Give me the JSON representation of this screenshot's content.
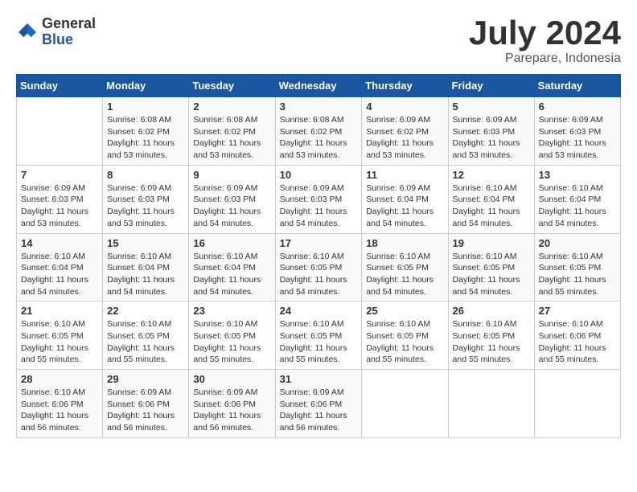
{
  "logo": {
    "general": "General",
    "blue": "Blue"
  },
  "title": "July 2024",
  "location": "Parepare, Indonesia",
  "headers": [
    "Sunday",
    "Monday",
    "Tuesday",
    "Wednesday",
    "Thursday",
    "Friday",
    "Saturday"
  ],
  "weeks": [
    [
      {
        "day": "",
        "sunrise": "",
        "sunset": "",
        "daylight": ""
      },
      {
        "day": "1",
        "sunrise": "Sunrise: 6:08 AM",
        "sunset": "Sunset: 6:02 PM",
        "daylight": "Daylight: 11 hours and 53 minutes."
      },
      {
        "day": "2",
        "sunrise": "Sunrise: 6:08 AM",
        "sunset": "Sunset: 6:02 PM",
        "daylight": "Daylight: 11 hours and 53 minutes."
      },
      {
        "day": "3",
        "sunrise": "Sunrise: 6:08 AM",
        "sunset": "Sunset: 6:02 PM",
        "daylight": "Daylight: 11 hours and 53 minutes."
      },
      {
        "day": "4",
        "sunrise": "Sunrise: 6:09 AM",
        "sunset": "Sunset: 6:02 PM",
        "daylight": "Daylight: 11 hours and 53 minutes."
      },
      {
        "day": "5",
        "sunrise": "Sunrise: 6:09 AM",
        "sunset": "Sunset: 6:03 PM",
        "daylight": "Daylight: 11 hours and 53 minutes."
      },
      {
        "day": "6",
        "sunrise": "Sunrise: 6:09 AM",
        "sunset": "Sunset: 6:03 PM",
        "daylight": "Daylight: 11 hours and 53 minutes."
      }
    ],
    [
      {
        "day": "7",
        "sunrise": "Sunrise: 6:09 AM",
        "sunset": "Sunset: 6:03 PM",
        "daylight": "Daylight: 11 hours and 53 minutes."
      },
      {
        "day": "8",
        "sunrise": "Sunrise: 6:09 AM",
        "sunset": "Sunset: 6:03 PM",
        "daylight": "Daylight: 11 hours and 53 minutes."
      },
      {
        "day": "9",
        "sunrise": "Sunrise: 6:09 AM",
        "sunset": "Sunset: 6:03 PM",
        "daylight": "Daylight: 11 hours and 54 minutes."
      },
      {
        "day": "10",
        "sunrise": "Sunrise: 6:09 AM",
        "sunset": "Sunset: 6:03 PM",
        "daylight": "Daylight: 11 hours and 54 minutes."
      },
      {
        "day": "11",
        "sunrise": "Sunrise: 6:09 AM",
        "sunset": "Sunset: 6:04 PM",
        "daylight": "Daylight: 11 hours and 54 minutes."
      },
      {
        "day": "12",
        "sunrise": "Sunrise: 6:10 AM",
        "sunset": "Sunset: 6:04 PM",
        "daylight": "Daylight: 11 hours and 54 minutes."
      },
      {
        "day": "13",
        "sunrise": "Sunrise: 6:10 AM",
        "sunset": "Sunset: 6:04 PM",
        "daylight": "Daylight: 11 hours and 54 minutes."
      }
    ],
    [
      {
        "day": "14",
        "sunrise": "Sunrise: 6:10 AM",
        "sunset": "Sunset: 6:04 PM",
        "daylight": "Daylight: 11 hours and 54 minutes."
      },
      {
        "day": "15",
        "sunrise": "Sunrise: 6:10 AM",
        "sunset": "Sunset: 6:04 PM",
        "daylight": "Daylight: 11 hours and 54 minutes."
      },
      {
        "day": "16",
        "sunrise": "Sunrise: 6:10 AM",
        "sunset": "Sunset: 6:04 PM",
        "daylight": "Daylight: 11 hours and 54 minutes."
      },
      {
        "day": "17",
        "sunrise": "Sunrise: 6:10 AM",
        "sunset": "Sunset: 6:05 PM",
        "daylight": "Daylight: 11 hours and 54 minutes."
      },
      {
        "day": "18",
        "sunrise": "Sunrise: 6:10 AM",
        "sunset": "Sunset: 6:05 PM",
        "daylight": "Daylight: 11 hours and 54 minutes."
      },
      {
        "day": "19",
        "sunrise": "Sunrise: 6:10 AM",
        "sunset": "Sunset: 6:05 PM",
        "daylight": "Daylight: 11 hours and 54 minutes."
      },
      {
        "day": "20",
        "sunrise": "Sunrise: 6:10 AM",
        "sunset": "Sunset: 6:05 PM",
        "daylight": "Daylight: 11 hours and 55 minutes."
      }
    ],
    [
      {
        "day": "21",
        "sunrise": "Sunrise: 6:10 AM",
        "sunset": "Sunset: 6:05 PM",
        "daylight": "Daylight: 11 hours and 55 minutes."
      },
      {
        "day": "22",
        "sunrise": "Sunrise: 6:10 AM",
        "sunset": "Sunset: 6:05 PM",
        "daylight": "Daylight: 11 hours and 55 minutes."
      },
      {
        "day": "23",
        "sunrise": "Sunrise: 6:10 AM",
        "sunset": "Sunset: 6:05 PM",
        "daylight": "Daylight: 11 hours and 55 minutes."
      },
      {
        "day": "24",
        "sunrise": "Sunrise: 6:10 AM",
        "sunset": "Sunset: 6:05 PM",
        "daylight": "Daylight: 11 hours and 55 minutes."
      },
      {
        "day": "25",
        "sunrise": "Sunrise: 6:10 AM",
        "sunset": "Sunset: 6:05 PM",
        "daylight": "Daylight: 11 hours and 55 minutes."
      },
      {
        "day": "26",
        "sunrise": "Sunrise: 6:10 AM",
        "sunset": "Sunset: 6:05 PM",
        "daylight": "Daylight: 11 hours and 55 minutes."
      },
      {
        "day": "27",
        "sunrise": "Sunrise: 6:10 AM",
        "sunset": "Sunset: 6:06 PM",
        "daylight": "Daylight: 11 hours and 55 minutes."
      }
    ],
    [
      {
        "day": "28",
        "sunrise": "Sunrise: 6:10 AM",
        "sunset": "Sunset: 6:06 PM",
        "daylight": "Daylight: 11 hours and 56 minutes."
      },
      {
        "day": "29",
        "sunrise": "Sunrise: 6:09 AM",
        "sunset": "Sunset: 6:06 PM",
        "daylight": "Daylight: 11 hours and 56 minutes."
      },
      {
        "day": "30",
        "sunrise": "Sunrise: 6:09 AM",
        "sunset": "Sunset: 6:06 PM",
        "daylight": "Daylight: 11 hours and 56 minutes."
      },
      {
        "day": "31",
        "sunrise": "Sunrise: 6:09 AM",
        "sunset": "Sunset: 6:06 PM",
        "daylight": "Daylight: 11 hours and 56 minutes."
      },
      {
        "day": "",
        "sunrise": "",
        "sunset": "",
        "daylight": ""
      },
      {
        "day": "",
        "sunrise": "",
        "sunset": "",
        "daylight": ""
      },
      {
        "day": "",
        "sunrise": "",
        "sunset": "",
        "daylight": ""
      }
    ]
  ]
}
